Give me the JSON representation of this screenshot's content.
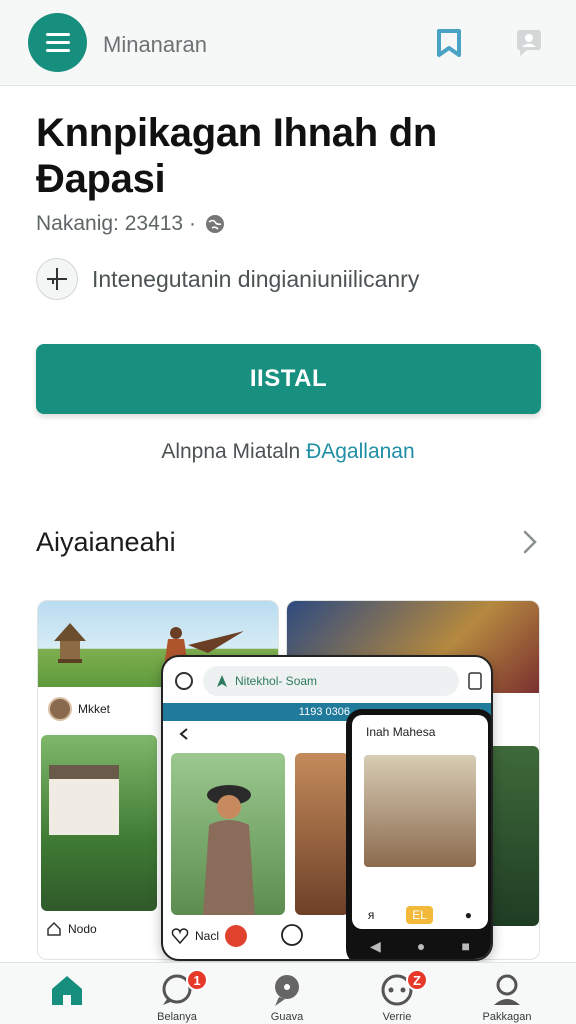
{
  "appbar": {
    "title": "Minanaran",
    "icons": [
      "menu-icon",
      "bookmark-icon",
      "profile-chat-icon"
    ],
    "accent": "#178f7e"
  },
  "header": {
    "title": "Knnpikagan Ihnah dn Đapasi",
    "meta": "Nakanig: 23413 ·",
    "meta_icon": "globe-icon",
    "category": "Intenegutanin dingianiuniilicanry",
    "category_icon": "crosshair-icon"
  },
  "install": {
    "label": "IISTAL",
    "color": "#17907f"
  },
  "subline": {
    "text": "Alnpna Miataln ",
    "link": "ĐAgallanan"
  },
  "section": {
    "title": "Aiyaianeahi",
    "icon": "chevron-right-icon"
  },
  "screens": {
    "left_user": "Mkket",
    "left_footer": "Nodo",
    "phone_search": "Nitekhol- Soam",
    "phone_band_left": "",
    "phone_band_center": "1193 0306",
    "phone_footer": "Nacl",
    "inner_title": "Inah Mahesa",
    "inner_tag": "EL"
  },
  "bottom_nav": {
    "items": [
      {
        "label": "",
        "icon": "home-icon",
        "badge": ""
      },
      {
        "label": "Belanya",
        "icon": "chat-icon",
        "badge": "1"
      },
      {
        "label": "Guava",
        "icon": "pin-icon",
        "badge": ""
      },
      {
        "label": "Verrie",
        "icon": "message-dots-icon",
        "badge": "Z"
      },
      {
        "label": "Pakkagan",
        "icon": "profile-icon",
        "badge": ""
      }
    ]
  }
}
